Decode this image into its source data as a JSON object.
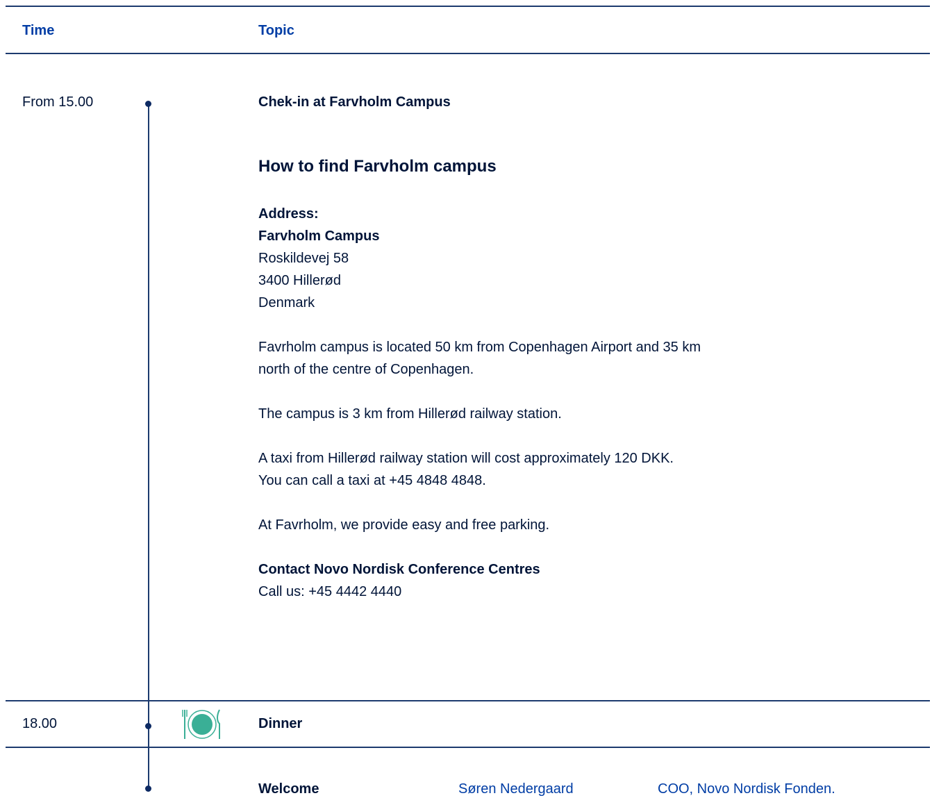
{
  "header": {
    "time_label": "Time",
    "topic_label": "Topic"
  },
  "rows": {
    "checkin": {
      "time": "From 15.00",
      "topic": "Chek-in at Farvholm Campus"
    },
    "directions": {
      "heading": "How to find Farvholm campus",
      "address_label": "Address:",
      "address_name": "Farvholm Campus",
      "address_street": "Roskildevej 58",
      "address_city": "3400 Hillerød",
      "address_country": "Denmark",
      "para1_line1": "Favrholm campus is located 50 km from Copenhagen Airport and 35 km",
      "para1_line2": "north of the centre of Copenhagen.",
      "para2": "The campus is 3 km from Hillerød railway station.",
      "para3_line1": "A taxi from Hillerød railway station will cost approximately 120 DKK.",
      "para3_line2": "You can call a taxi at +45 4848 4848.",
      "para4": "At Favrholm, we provide easy and free parking.",
      "contact_title": "Contact Novo Nordisk Conference Centres",
      "contact_phone": "Call us: +45 4442 4440"
    },
    "dinner": {
      "time": "18.00",
      "topic": "Dinner",
      "icon": "dinner-plate-icon"
    },
    "welcome": {
      "topic": "Welcome",
      "speaker": "Søren Nedergaard",
      "role": "COO, Novo Nordisk Fonden."
    }
  },
  "colors": {
    "primary_text": "#001438",
    "accent_blue": "#003da5",
    "rule": "#1c3a6e",
    "icon_green": "#3aaf96"
  }
}
